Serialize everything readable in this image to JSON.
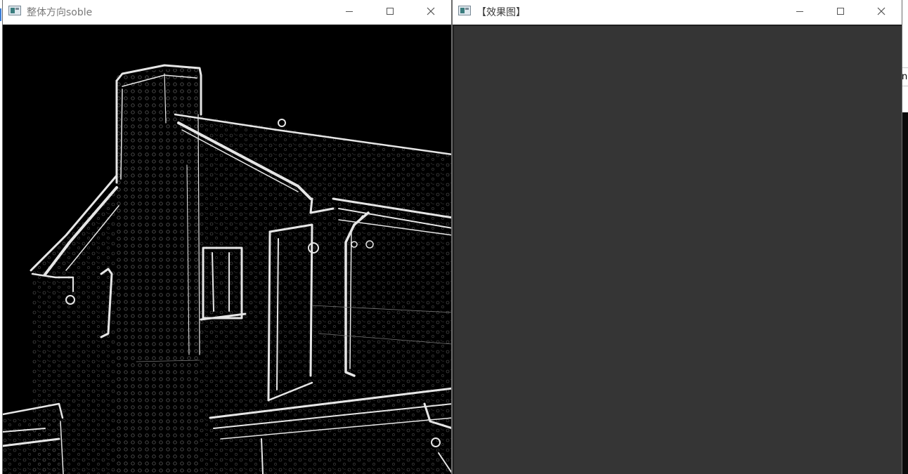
{
  "windows": [
    {
      "title": "整体方向soble",
      "active": false,
      "content": "sobel-edge-image-house"
    },
    {
      "title": "【效果图】",
      "active": true,
      "content": "blank-dark-gray-image"
    }
  ],
  "background_window": {
    "text_fragment": "n("
  },
  "icons": {
    "app": "opencv-window-icon",
    "minimize": "minimize-icon",
    "maximize": "maximize-icon",
    "close": "close-icon"
  },
  "colors": {
    "left_canvas": "#000000",
    "right_canvas": "#353535",
    "edge_stroke": "#e6e6e6"
  }
}
